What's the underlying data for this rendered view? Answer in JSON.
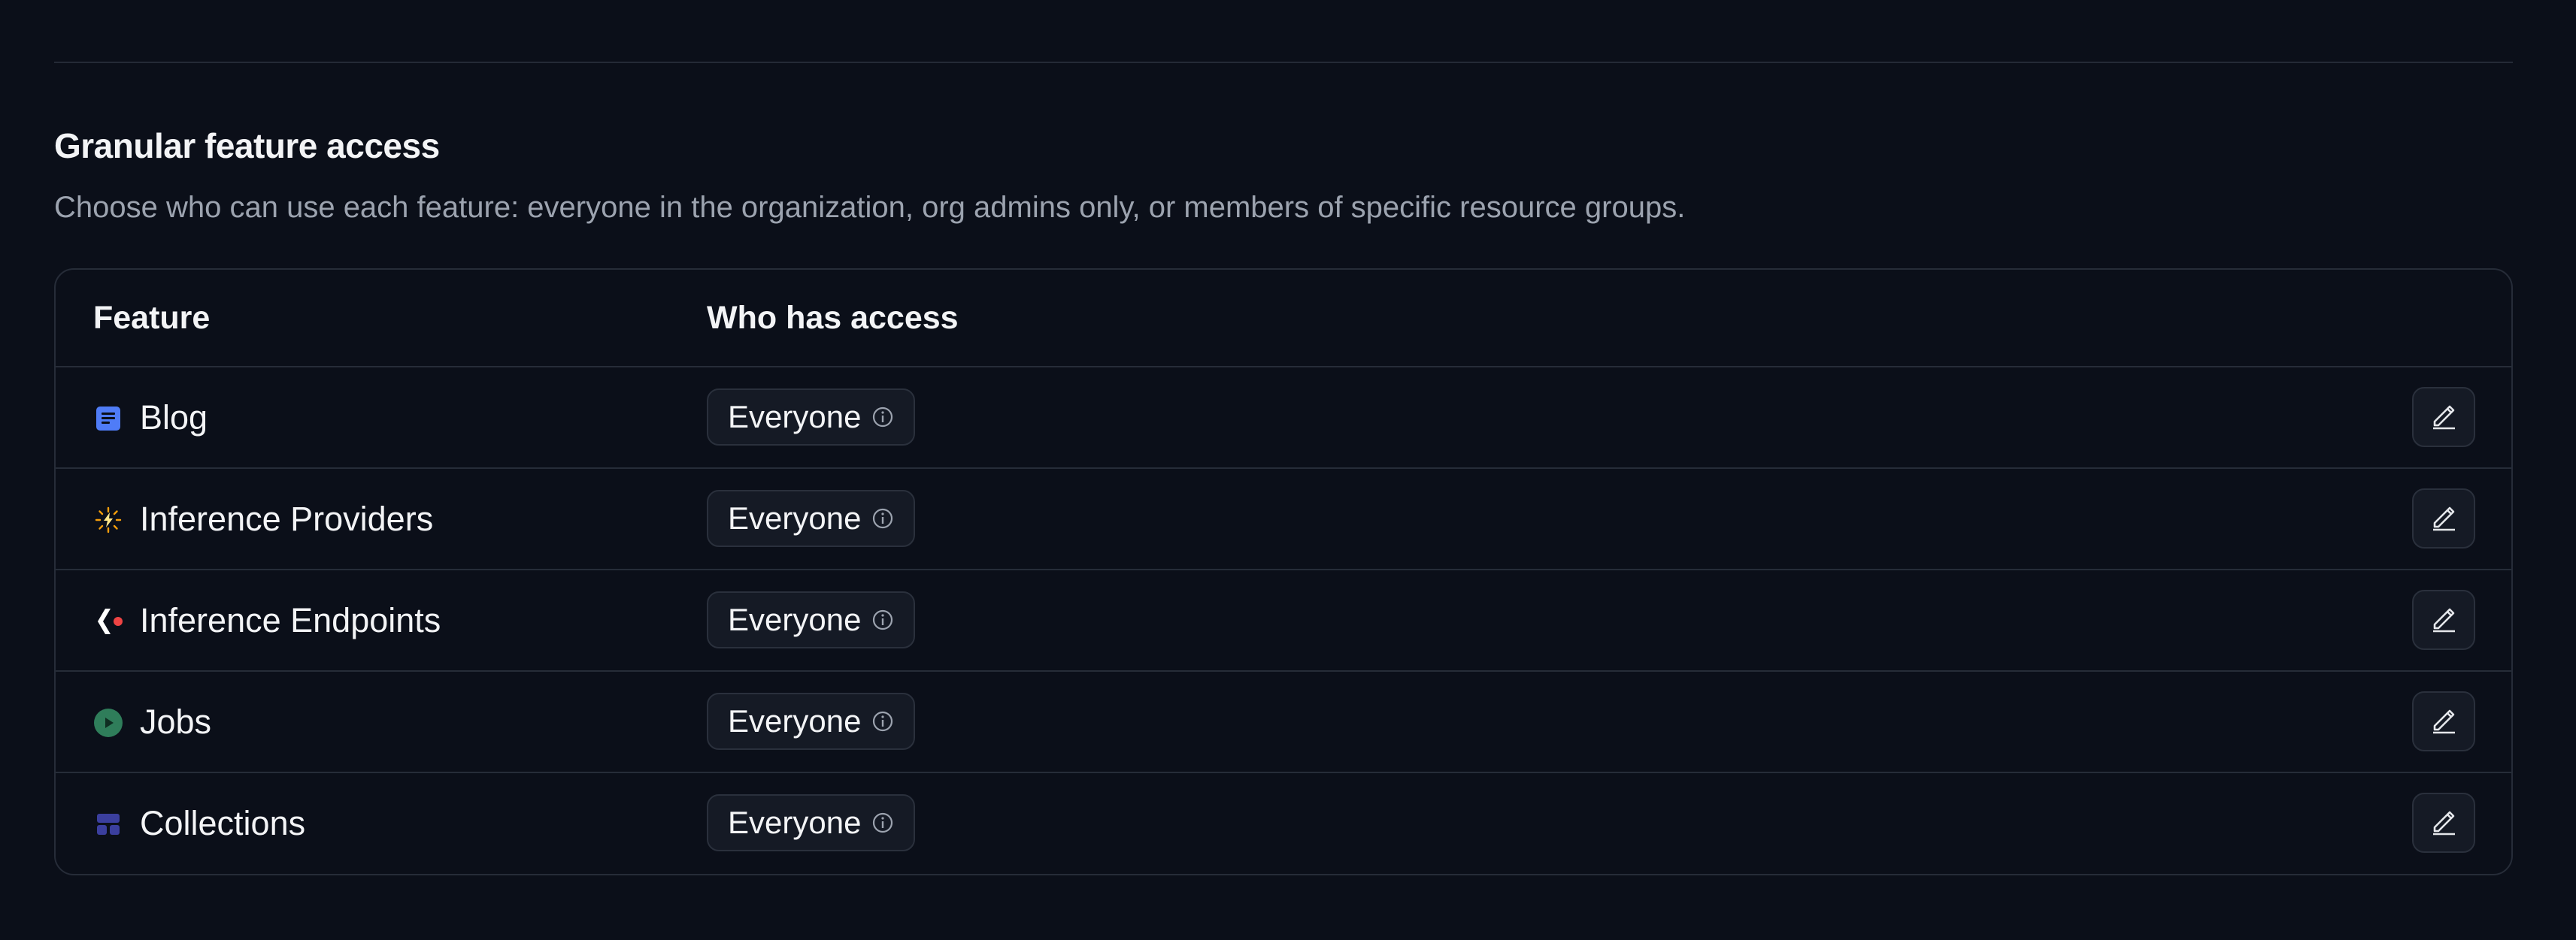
{
  "section": {
    "title": "Granular feature access",
    "description": "Choose who can use each feature: everyone in the organization, org admins only, or members of specific resource groups."
  },
  "table": {
    "headers": {
      "feature": "Feature",
      "access": "Who has access"
    },
    "rows": [
      {
        "feature": "Blog",
        "icon": "blog-icon",
        "access": "Everyone"
      },
      {
        "feature": "Inference Providers",
        "icon": "inference-providers-icon",
        "access": "Everyone"
      },
      {
        "feature": "Inference Endpoints",
        "icon": "inference-endpoints-icon",
        "access": "Everyone"
      },
      {
        "feature": "Jobs",
        "icon": "jobs-icon",
        "access": "Everyone"
      },
      {
        "feature": "Collections",
        "icon": "collections-icon",
        "access": "Everyone"
      }
    ]
  },
  "colors": {
    "background": "#0b0f19",
    "border": "#262c38",
    "blog": "#4f7cf7",
    "inference_providers": "#f59e0b",
    "inference_endpoints": "#ef4444",
    "jobs": "#2f7d5a",
    "collections": "#3b3f9e"
  }
}
